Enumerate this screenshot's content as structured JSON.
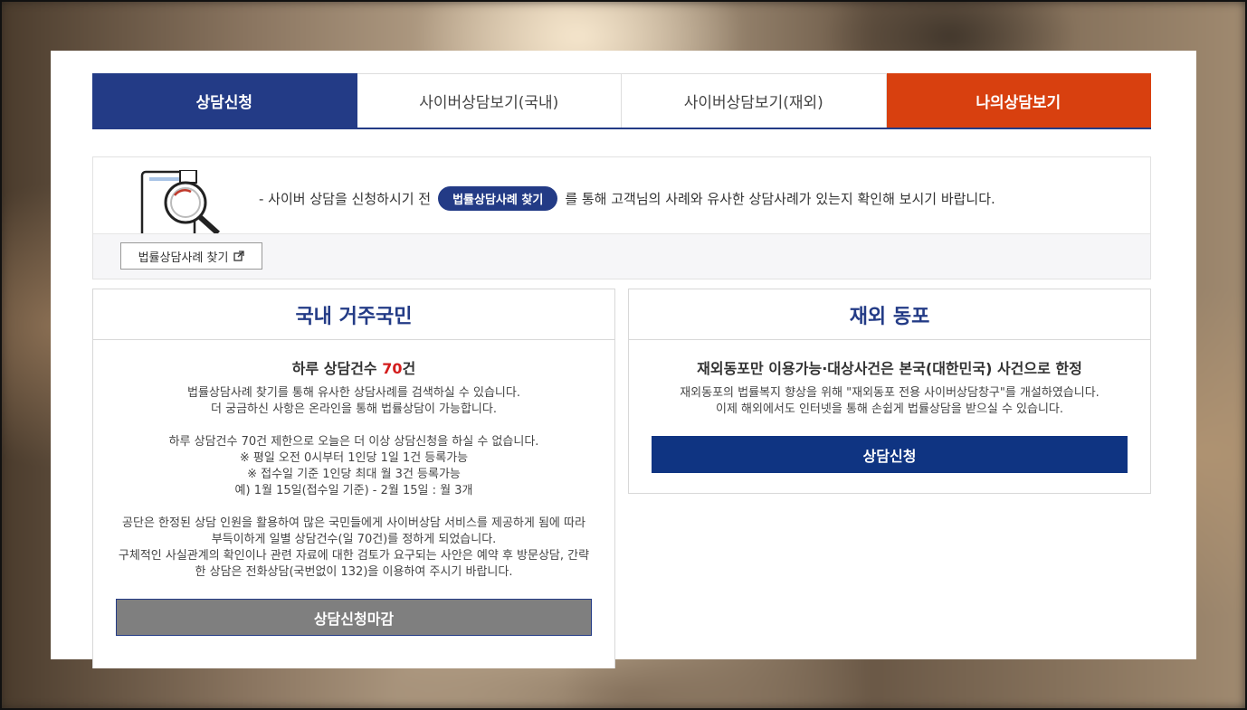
{
  "tabs": [
    {
      "label": "상담신청"
    },
    {
      "label": "사이버상담보기(국내)"
    },
    {
      "label": "사이버상담보기(재외)"
    },
    {
      "label": "나의상담보기"
    }
  ],
  "notice": {
    "prefix": "- 사이버 상담을 신청하시기 전",
    "pill_label": "법률상담사례 찾기",
    "suffix": "를 통해 고객님의 사례와 유사한 상담사례가 있는지 확인해 보시기 바랍니다.",
    "search_button": "법률상담사례 찾기"
  },
  "domestic": {
    "title": "국내 거주국민",
    "subtitle_prefix": "하루 상담건수 ",
    "subtitle_count": "70",
    "subtitle_suffix": "건",
    "lines1": [
      "법률상담사례 찾기를 통해 유사한 상담사례를 검색하실 수 있습니다.",
      "더 궁금하신 사항은 온라인을 통해 법률상담이 가능합니다."
    ],
    "lines2": [
      "하루 상담건수 70건 제한으로 오늘은 더 이상 상담신청을 하실 수 없습니다.",
      "※ 평일 오전 0시부터 1인당 1일 1건 등록가능",
      "※ 접수일 기준 1인당 최대 월 3건 등록가능",
      "예) 1월 15일(접수일 기준) - 2월 15일 : 월 3개"
    ],
    "lines3": [
      "공단은 한정된 상담 인원을 활용하여 많은 국민들에게 사이버상담 서비스를 제공하게 됨에 따라",
      "부득이하게 일별 상담건수(일 70건)를 정하게 되었습니다.",
      "구체적인 사실관계의 확인이나 관련 자료에 대한 검토가 요구되는 사안은 예약 후 방문상담, 간략",
      "한 상담은 전화상담(국번없이 132)을 이용하여 주시기 바랍니다."
    ],
    "button": "상담신청마감"
  },
  "overseas": {
    "title": "재외 동포",
    "subtitle": "재외동포만 이용가능·대상사건은 본국(대한민국) 사건으로 한정",
    "lines": [
      "재외동포의 법률복지 향상을 위해 \"재외동포 전용 사이버상담창구\"를 개설하였습니다.",
      "이제 해외에서도 인터넷을 통해 손쉽게 법률상담을 받으실 수 있습니다."
    ],
    "button": "상담신청"
  },
  "colors": {
    "navy": "#233b86",
    "orange": "#d8400f",
    "button_blue": "#0f3482",
    "closed_gray": "#7f7f7f",
    "count_red": "#d31c1c"
  },
  "icons": {
    "notice": "magnifier-document-icon",
    "external_link": "external-link-icon"
  }
}
